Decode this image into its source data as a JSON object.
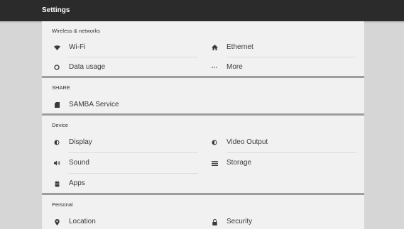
{
  "app_bar": {
    "title": "Settings"
  },
  "sections": {
    "wireless": {
      "header": "Wireless & networks",
      "wifi": {
        "label": "Wi-Fi",
        "icon": "wifi-icon"
      },
      "ethernet": {
        "label": "Ethernet",
        "icon": "ethernet-icon"
      },
      "data_usage": {
        "label": "Data usage",
        "icon": "data-usage-icon"
      },
      "more": {
        "label": "More",
        "icon": "more-icon"
      }
    },
    "share": {
      "header": "SHARE",
      "samba": {
        "label": "SAMBA Service",
        "icon": "samba-icon"
      }
    },
    "device": {
      "header": "Device",
      "display": {
        "label": "Display",
        "icon": "display-icon"
      },
      "video_output": {
        "label": "Video Output",
        "icon": "video-output-icon"
      },
      "sound": {
        "label": "Sound",
        "icon": "sound-icon"
      },
      "storage": {
        "label": "Storage",
        "icon": "storage-icon"
      },
      "apps": {
        "label": "Apps",
        "icon": "apps-icon"
      }
    },
    "personal": {
      "header": "Personal",
      "location": {
        "label": "Location",
        "icon": "location-icon"
      },
      "security": {
        "label": "Security",
        "icon": "security-icon"
      }
    }
  },
  "colors": {
    "app_bar": "#2b2b2b",
    "background": "#d6d6d6",
    "card": "#f1f1f1",
    "section_separator": "#9d9d9d",
    "text": "#3a3a3a"
  }
}
